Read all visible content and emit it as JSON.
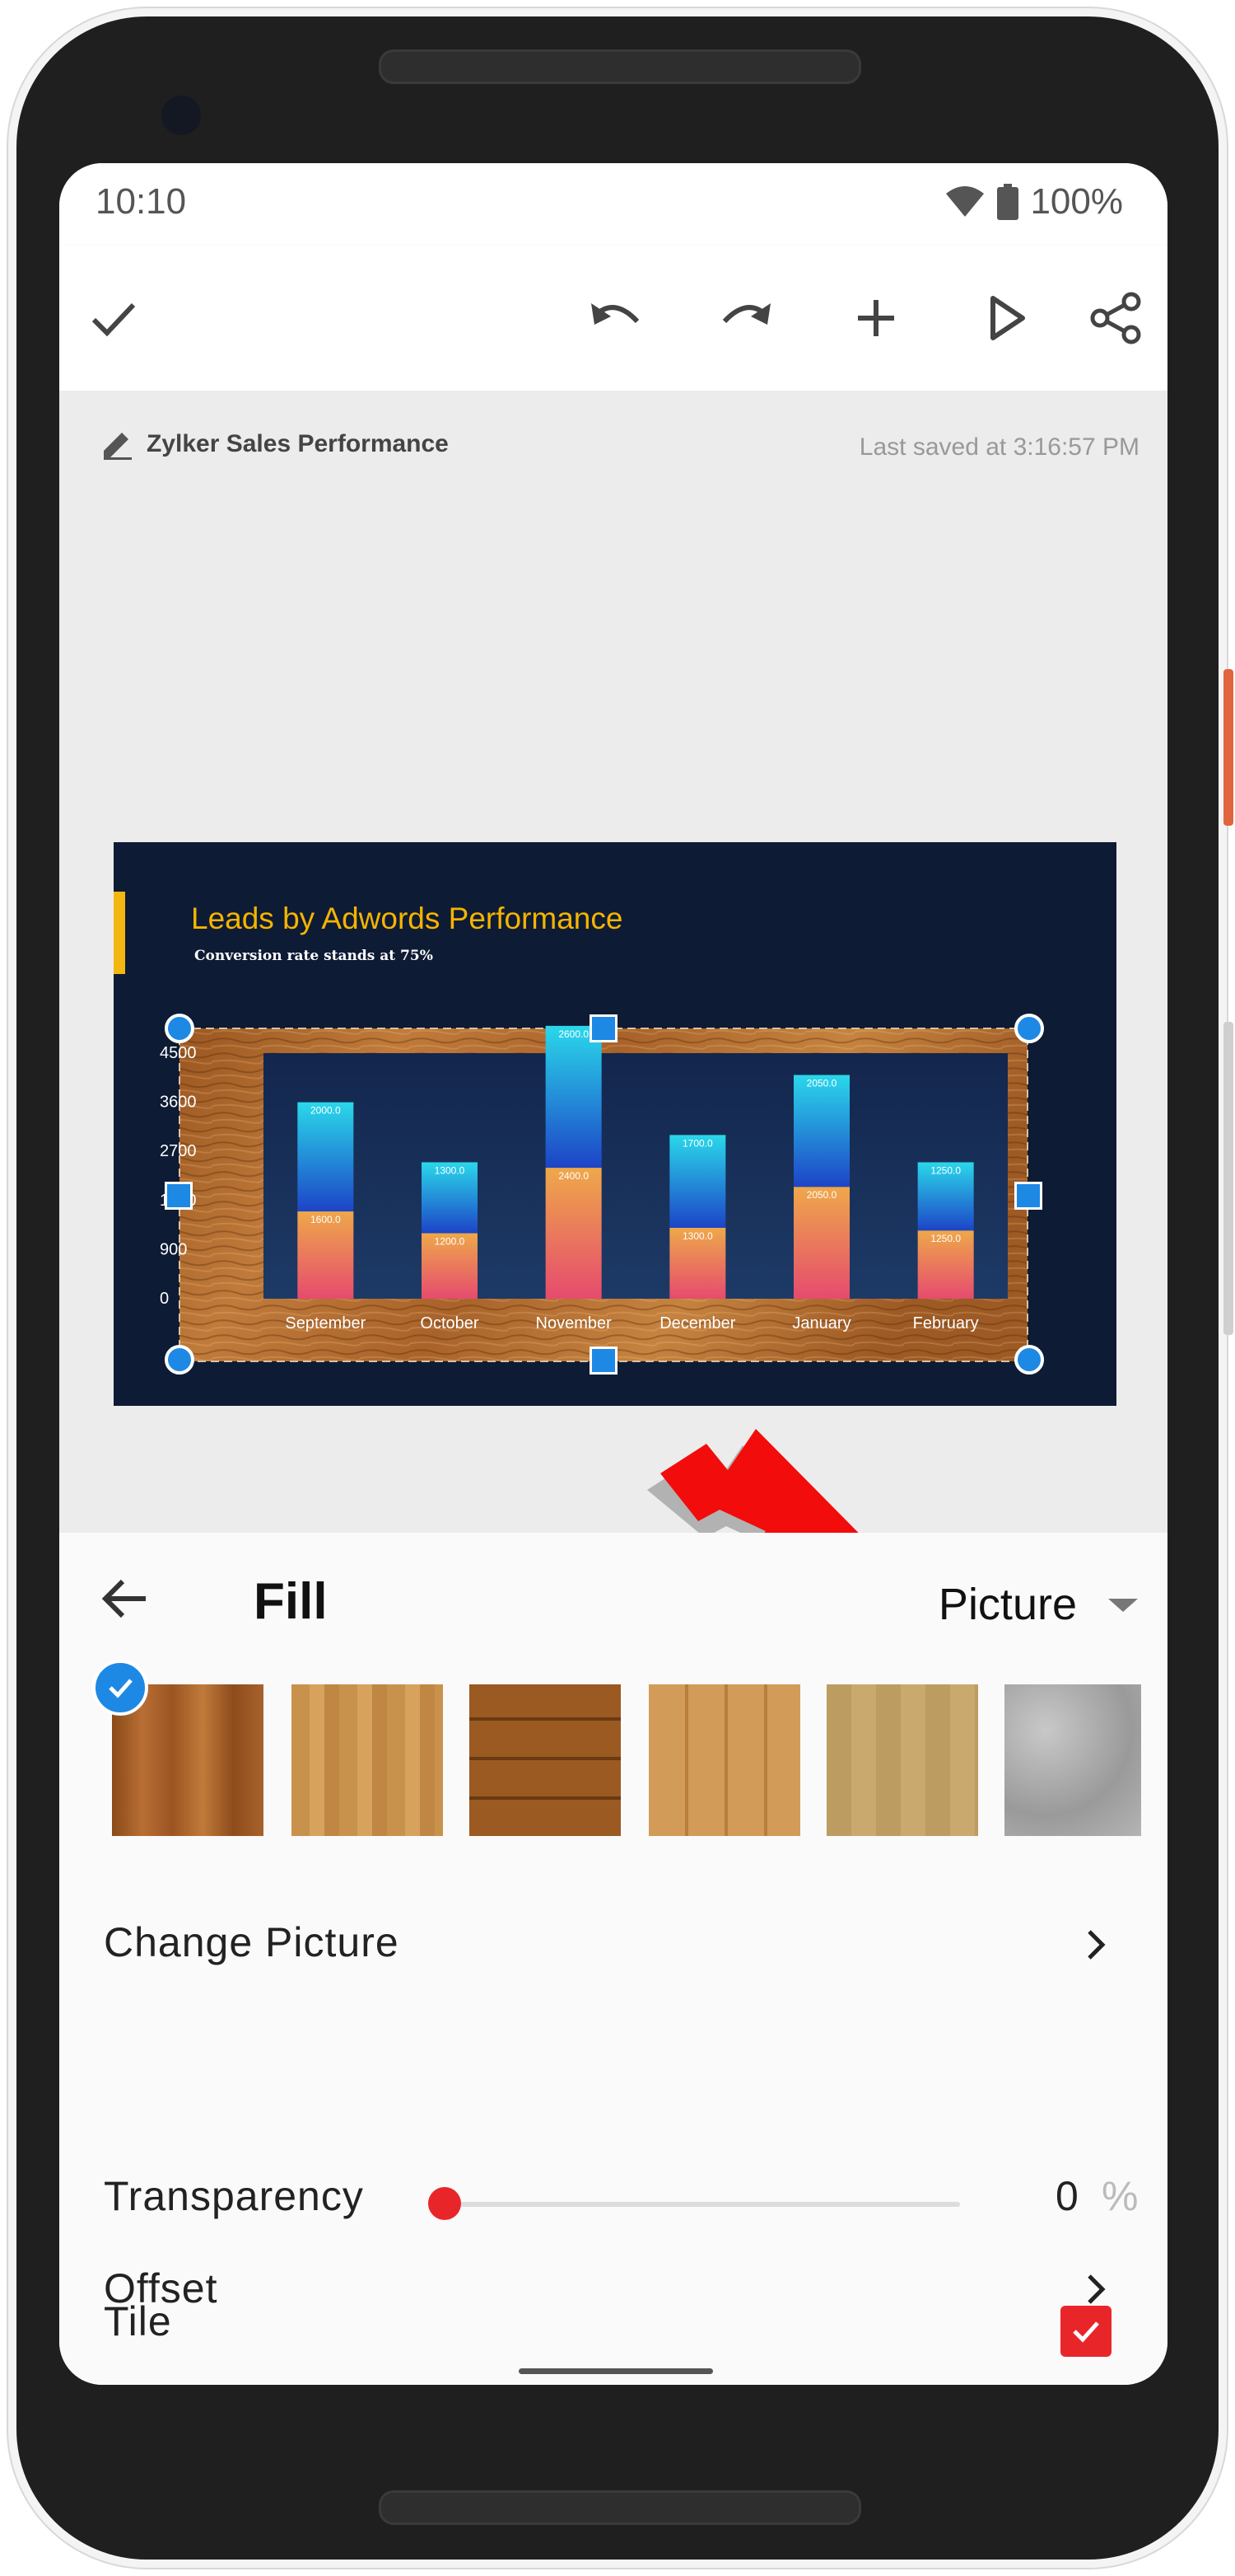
{
  "status_bar": {
    "time": "10:10",
    "battery": "100%"
  },
  "toolbar": {
    "buttons": [
      "done",
      "undo",
      "redo",
      "add",
      "play",
      "share"
    ],
    "accent": "#444444"
  },
  "document": {
    "title": "Zylker Sales Performance",
    "last_saved": "Last saved at 3:16:57 PM"
  },
  "slide": {
    "title": "Leads by Adwords Performance",
    "subtitle": "Conversion rate stands at 75%",
    "background": "#0e1b35",
    "accent": "#f3b712"
  },
  "chart_data": {
    "type": "bar",
    "stacked": true,
    "categories": [
      "September",
      "October",
      "November",
      "December",
      "January",
      "February"
    ],
    "series": [
      {
        "values": [
          1600.0,
          1200.0,
          2400.0,
          1300.0,
          2050.0,
          1250.0
        ],
        "labels": [
          "1600.0",
          "1200.0",
          "2400.0",
          "1300.0",
          "2050.0",
          "1250.0"
        ],
        "color": "#ec8b4e"
      },
      {
        "values": [
          2000.0,
          1300.0,
          2600.0,
          1700.0,
          2050.0,
          1250.0
        ],
        "labels": [
          "2000.0",
          "1300.0",
          "2600.0",
          "1700.0",
          "2050.0",
          "1250.0"
        ],
        "color": "#1fb6e5"
      }
    ],
    "yticks": [
      "4500",
      "3600",
      "2700",
      "1800",
      "900",
      "0"
    ],
    "ylim": [
      0,
      4500
    ],
    "plot_background": "wood",
    "legend": false
  },
  "fill_panel": {
    "title": "Fill",
    "fill_type": "Picture",
    "swatches": [
      "wood-1",
      "wood-2",
      "wood-3",
      "wood-4",
      "wood-5",
      "granite"
    ],
    "selected_swatch": "wood-1",
    "rows": {
      "change_picture": "Change Picture",
      "transparency": "Transparency",
      "transparency_value": "0",
      "transparency_unit": "%",
      "tile": "Tile",
      "offset": "Offset"
    },
    "tile_checked": true,
    "accent": "#e8262a"
  }
}
